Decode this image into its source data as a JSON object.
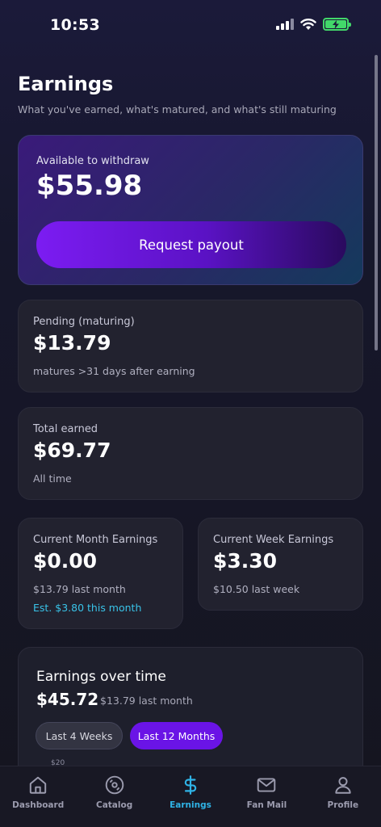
{
  "status": {
    "time": "10:53"
  },
  "header": {
    "title": "Earnings",
    "subtitle": "What you've earned, what's matured, and what's still maturing"
  },
  "withdraw": {
    "label": "Available to withdraw",
    "amount": "$55.98",
    "button_label": "Request payout"
  },
  "pending": {
    "label": "Pending (maturing)",
    "amount": "$13.79",
    "note": "matures >31 days after earning"
  },
  "total": {
    "label": "Total earned",
    "amount": "$69.77",
    "note": "All time"
  },
  "month": {
    "label": "Current Month Earnings",
    "amount": "$0.00",
    "note": "$13.79 last month",
    "estimate": "Est. $3.80 this month"
  },
  "week": {
    "label": "Current Week Earnings",
    "amount": "$3.30",
    "note": "$10.50 last week"
  },
  "chart": {
    "title": "Earnings over time",
    "amount": "$45.72",
    "sub": "$13.79 last month",
    "tabs": [
      "Last 4 Weeks",
      "Last 12 Months"
    ],
    "active_tab": "Last 12 Months",
    "top_tick": "$20"
  },
  "nav": {
    "items": [
      {
        "label": "Dashboard",
        "icon": "home-icon"
      },
      {
        "label": "Catalog",
        "icon": "disc-icon"
      },
      {
        "label": "Earnings",
        "icon": "dollar-icon",
        "active": true
      },
      {
        "label": "Fan Mail",
        "icon": "mail-icon"
      },
      {
        "label": "Profile",
        "icon": "person-icon"
      }
    ]
  },
  "colors": {
    "accent": "#6a14e6",
    "active_nav": "#2fb3e6",
    "estimate": "#39c3e8",
    "battery": "#42d86a"
  }
}
